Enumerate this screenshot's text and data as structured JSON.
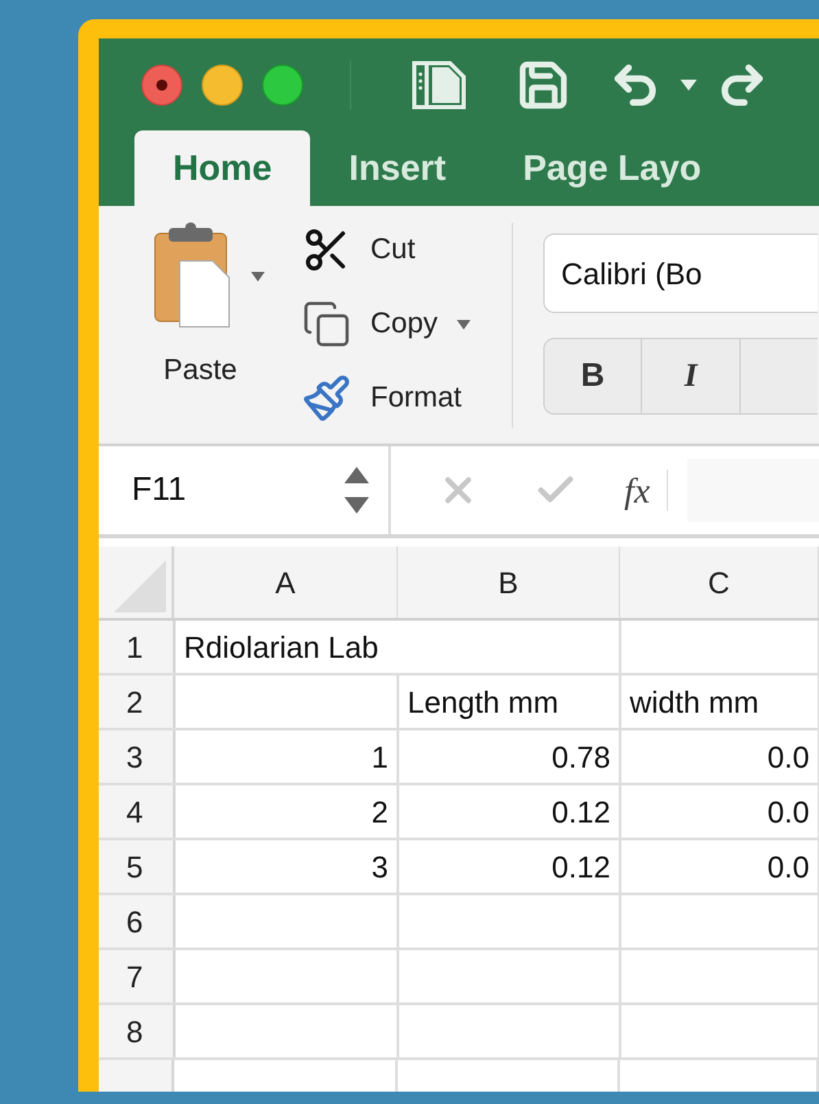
{
  "tabs": [
    {
      "label": "Home",
      "selected": true
    },
    {
      "label": "Insert",
      "selected": false
    },
    {
      "label": "Page Layo",
      "selected": false
    }
  ],
  "clipboard": {
    "paste": "Paste",
    "cut": "Cut",
    "copy": "Copy",
    "format": "Format"
  },
  "font": {
    "name": "Calibri (Bo",
    "bold": "B",
    "italic": "I"
  },
  "formula_bar": {
    "name_box": "F11",
    "function_label": "fx"
  },
  "sheet": {
    "columns": [
      "A",
      "B",
      "C"
    ],
    "rows": [
      {
        "number": "1",
        "cells": [
          {
            "text": "Rdiolarian Lab",
            "kind": "text"
          },
          {
            "kind": "empty"
          },
          {
            "kind": "empty"
          }
        ]
      },
      {
        "number": "2",
        "cells": [
          {
            "kind": "empty"
          },
          {
            "text": "Length mm",
            "kind": "text"
          },
          {
            "text": "width mm",
            "kind": "text"
          }
        ]
      },
      {
        "number": "3",
        "cells": [
          {
            "text": "1",
            "kind": "number"
          },
          {
            "text": "0.78",
            "kind": "number"
          },
          {
            "text": "0.0",
            "kind": "number"
          }
        ]
      },
      {
        "number": "4",
        "cells": [
          {
            "text": "2",
            "kind": "number"
          },
          {
            "text": "0.12",
            "kind": "number"
          },
          {
            "text": "0.0",
            "kind": "number"
          }
        ]
      },
      {
        "number": "5",
        "cells": [
          {
            "text": "3",
            "kind": "number"
          },
          {
            "text": "0.12",
            "kind": "number"
          },
          {
            "text": "0.0",
            "kind": "number"
          }
        ]
      },
      {
        "number": "6"
      },
      {
        "number": "7"
      },
      {
        "number": "8"
      }
    ]
  }
}
